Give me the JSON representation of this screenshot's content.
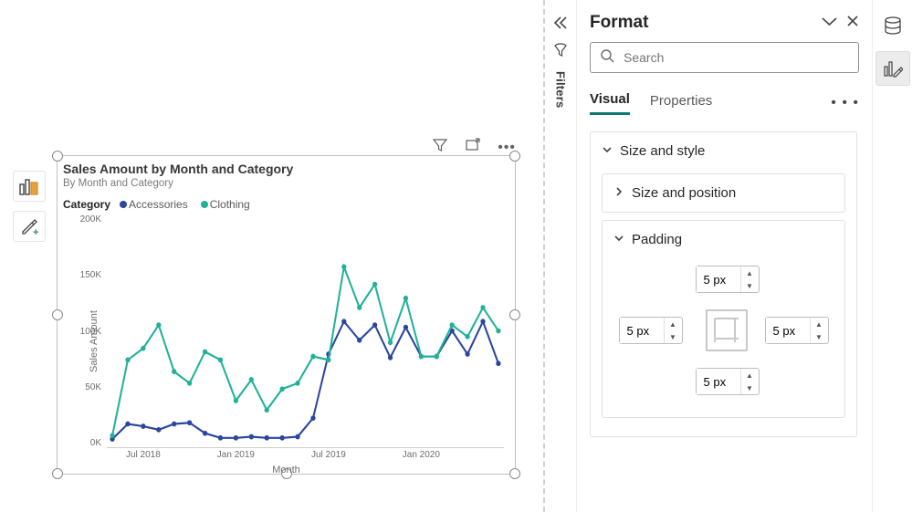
{
  "left_rail": {
    "viz_icon": "visualizations-icon",
    "format_icon": "format-icon"
  },
  "viz_toolbar": {
    "filter": "filter-icon",
    "focus": "focus-mode-icon",
    "more": "more-options-icon"
  },
  "chart": {
    "title": "Sales Amount by Month and Category",
    "subtitle": "By Month and Category",
    "legend_label": "Category",
    "y_label": "Sales Amount",
    "x_label": "Month",
    "y_ticks": [
      "200K",
      "150K",
      "100K",
      "50K",
      "0K"
    ],
    "x_ticks": [
      "Jul 2018",
      "Jan 2019",
      "Jul 2019",
      "Jan 2020"
    ],
    "series": [
      {
        "name": "Accessories",
        "color": "#2a469e"
      },
      {
        "name": "Clothing",
        "color": "#1fb298"
      }
    ]
  },
  "filters": {
    "label": "Filters"
  },
  "format": {
    "title": "Format",
    "search_placeholder": "Search",
    "tabs": {
      "visual": "Visual",
      "properties": "Properties"
    },
    "sections": {
      "size_style": "Size and style",
      "size_position": "Size and position",
      "padding": "Padding"
    },
    "padding": {
      "top": "5 px",
      "left": "5 px",
      "right": "5 px",
      "bottom": "5 px"
    }
  },
  "chart_data": {
    "type": "line",
    "title": "Sales Amount by Month and Category",
    "xlabel": "Month",
    "ylabel": "Sales Amount",
    "ylim": [
      0,
      200000
    ],
    "x": [
      "2018-05",
      "2018-06",
      "2018-07",
      "2018-08",
      "2018-09",
      "2018-10",
      "2018-11",
      "2018-12",
      "2019-01",
      "2019-02",
      "2019-03",
      "2019-04",
      "2019-05",
      "2019-06",
      "2019-07",
      "2019-08",
      "2019-09",
      "2019-10",
      "2019-11",
      "2019-12",
      "2020-01",
      "2020-02",
      "2020-03",
      "2020-04",
      "2020-05",
      "2020-06"
    ],
    "series": [
      {
        "name": "Accessories",
        "color": "#2a469e",
        "values": [
          7000,
          20000,
          18000,
          15000,
          20000,
          21000,
          12000,
          8000,
          8000,
          9000,
          8000,
          8000,
          9000,
          25000,
          80000,
          108000,
          92000,
          105000,
          77000,
          103000,
          78000,
          78000,
          100000,
          80000,
          108000,
          72000
        ]
      },
      {
        "name": "Clothing",
        "color": "#1fb298",
        "values": [
          10000,
          75000,
          85000,
          105000,
          65000,
          55000,
          82000,
          75000,
          40000,
          58000,
          32000,
          50000,
          55000,
          78000,
          75000,
          155000,
          120000,
          140000,
          90000,
          128000,
          78000,
          78000,
          105000,
          95000,
          120000,
          100000
        ]
      }
    ],
    "x_tick_labels": {
      "2": "Jul 2018",
      "8": "Jan 2019",
      "14": "Jul 2019",
      "20": "Jan 2020"
    }
  },
  "colors": {
    "accent": "#0d7a6f"
  }
}
